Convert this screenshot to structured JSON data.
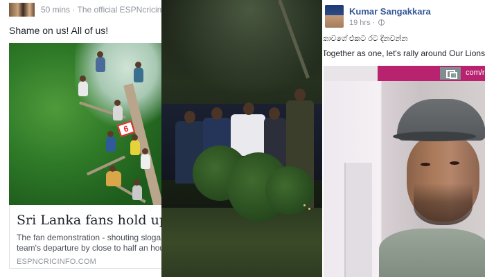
{
  "left_post": {
    "time_ago": "50 mins",
    "separator": "·",
    "source_desc": "The official ESPNcricinfo",
    "status_text": "Shame on us! All of us!",
    "photo_sign": "6",
    "link_card": {
      "title": "Sri Lanka fans hold up team",
      "description_line1": "The fan demonstration - shouting slogans",
      "description_line2": "team's departure by close to half an hour",
      "source": "ESPNCRICINFO.COM"
    }
  },
  "video_frame": {
    "description": ""
  },
  "right_post": {
    "author": "Kumar Sangakkara",
    "time_ago": "19 hrs",
    "separator": "·",
    "privacy_icon": "globe-icon",
    "text_line1": "කාවගේ එකට රට දිනවන්න",
    "text_line2": "Together as one, let's rally around Our Lions.",
    "video_url_fragment": "com/rata"
  },
  "colors": {
    "link_blue": "#365899",
    "meta_gray": "#90949c",
    "text_dark": "#1d2129",
    "video_strip": "#b8226e"
  }
}
